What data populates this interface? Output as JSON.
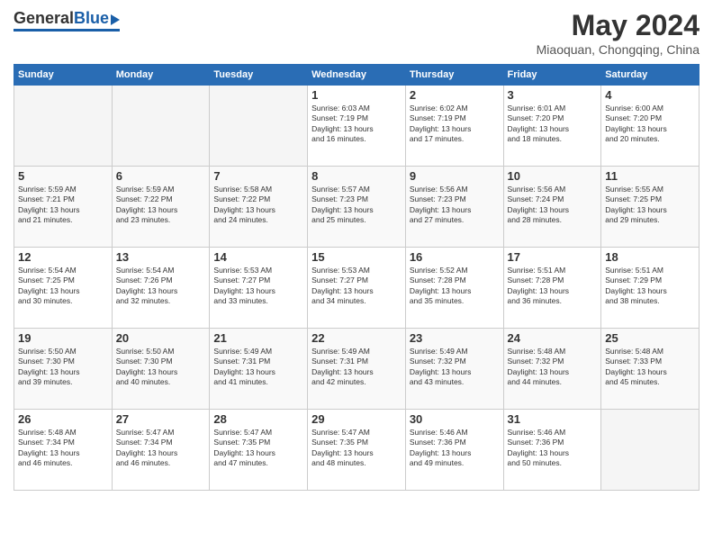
{
  "header": {
    "logo": {
      "general": "General",
      "blue": "Blue"
    },
    "title": "May 2024",
    "location": "Miaoquan, Chongqing, China"
  },
  "weekdays": [
    "Sunday",
    "Monday",
    "Tuesday",
    "Wednesday",
    "Thursday",
    "Friday",
    "Saturday"
  ],
  "weeks": [
    [
      {
        "day": "",
        "info": ""
      },
      {
        "day": "",
        "info": ""
      },
      {
        "day": "",
        "info": ""
      },
      {
        "day": "1",
        "info": "Sunrise: 6:03 AM\nSunset: 7:19 PM\nDaylight: 13 hours\nand 16 minutes."
      },
      {
        "day": "2",
        "info": "Sunrise: 6:02 AM\nSunset: 7:19 PM\nDaylight: 13 hours\nand 17 minutes."
      },
      {
        "day": "3",
        "info": "Sunrise: 6:01 AM\nSunset: 7:20 PM\nDaylight: 13 hours\nand 18 minutes."
      },
      {
        "day": "4",
        "info": "Sunrise: 6:00 AM\nSunset: 7:20 PM\nDaylight: 13 hours\nand 20 minutes."
      }
    ],
    [
      {
        "day": "5",
        "info": "Sunrise: 5:59 AM\nSunset: 7:21 PM\nDaylight: 13 hours\nand 21 minutes."
      },
      {
        "day": "6",
        "info": "Sunrise: 5:59 AM\nSunset: 7:22 PM\nDaylight: 13 hours\nand 23 minutes."
      },
      {
        "day": "7",
        "info": "Sunrise: 5:58 AM\nSunset: 7:22 PM\nDaylight: 13 hours\nand 24 minutes."
      },
      {
        "day": "8",
        "info": "Sunrise: 5:57 AM\nSunset: 7:23 PM\nDaylight: 13 hours\nand 25 minutes."
      },
      {
        "day": "9",
        "info": "Sunrise: 5:56 AM\nSunset: 7:23 PM\nDaylight: 13 hours\nand 27 minutes."
      },
      {
        "day": "10",
        "info": "Sunrise: 5:56 AM\nSunset: 7:24 PM\nDaylight: 13 hours\nand 28 minutes."
      },
      {
        "day": "11",
        "info": "Sunrise: 5:55 AM\nSunset: 7:25 PM\nDaylight: 13 hours\nand 29 minutes."
      }
    ],
    [
      {
        "day": "12",
        "info": "Sunrise: 5:54 AM\nSunset: 7:25 PM\nDaylight: 13 hours\nand 30 minutes."
      },
      {
        "day": "13",
        "info": "Sunrise: 5:54 AM\nSunset: 7:26 PM\nDaylight: 13 hours\nand 32 minutes."
      },
      {
        "day": "14",
        "info": "Sunrise: 5:53 AM\nSunset: 7:27 PM\nDaylight: 13 hours\nand 33 minutes."
      },
      {
        "day": "15",
        "info": "Sunrise: 5:53 AM\nSunset: 7:27 PM\nDaylight: 13 hours\nand 34 minutes."
      },
      {
        "day": "16",
        "info": "Sunrise: 5:52 AM\nSunset: 7:28 PM\nDaylight: 13 hours\nand 35 minutes."
      },
      {
        "day": "17",
        "info": "Sunrise: 5:51 AM\nSunset: 7:28 PM\nDaylight: 13 hours\nand 36 minutes."
      },
      {
        "day": "18",
        "info": "Sunrise: 5:51 AM\nSunset: 7:29 PM\nDaylight: 13 hours\nand 38 minutes."
      }
    ],
    [
      {
        "day": "19",
        "info": "Sunrise: 5:50 AM\nSunset: 7:30 PM\nDaylight: 13 hours\nand 39 minutes."
      },
      {
        "day": "20",
        "info": "Sunrise: 5:50 AM\nSunset: 7:30 PM\nDaylight: 13 hours\nand 40 minutes."
      },
      {
        "day": "21",
        "info": "Sunrise: 5:49 AM\nSunset: 7:31 PM\nDaylight: 13 hours\nand 41 minutes."
      },
      {
        "day": "22",
        "info": "Sunrise: 5:49 AM\nSunset: 7:31 PM\nDaylight: 13 hours\nand 42 minutes."
      },
      {
        "day": "23",
        "info": "Sunrise: 5:49 AM\nSunset: 7:32 PM\nDaylight: 13 hours\nand 43 minutes."
      },
      {
        "day": "24",
        "info": "Sunrise: 5:48 AM\nSunset: 7:32 PM\nDaylight: 13 hours\nand 44 minutes."
      },
      {
        "day": "25",
        "info": "Sunrise: 5:48 AM\nSunset: 7:33 PM\nDaylight: 13 hours\nand 45 minutes."
      }
    ],
    [
      {
        "day": "26",
        "info": "Sunrise: 5:48 AM\nSunset: 7:34 PM\nDaylight: 13 hours\nand 46 minutes."
      },
      {
        "day": "27",
        "info": "Sunrise: 5:47 AM\nSunset: 7:34 PM\nDaylight: 13 hours\nand 46 minutes."
      },
      {
        "day": "28",
        "info": "Sunrise: 5:47 AM\nSunset: 7:35 PM\nDaylight: 13 hours\nand 47 minutes."
      },
      {
        "day": "29",
        "info": "Sunrise: 5:47 AM\nSunset: 7:35 PM\nDaylight: 13 hours\nand 48 minutes."
      },
      {
        "day": "30",
        "info": "Sunrise: 5:46 AM\nSunset: 7:36 PM\nDaylight: 13 hours\nand 49 minutes."
      },
      {
        "day": "31",
        "info": "Sunrise: 5:46 AM\nSunset: 7:36 PM\nDaylight: 13 hours\nand 50 minutes."
      },
      {
        "day": "",
        "info": ""
      }
    ]
  ]
}
